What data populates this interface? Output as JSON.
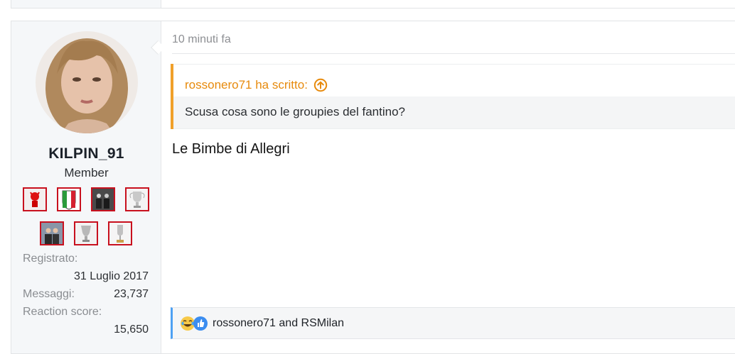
{
  "user": {
    "username": "KILPIN_91",
    "title": "Member",
    "badges": [
      {
        "name": "devil-trophy-badge"
      },
      {
        "name": "italian-shield-badge"
      },
      {
        "name": "team-photo-badge"
      },
      {
        "name": "champions-cup-badge"
      },
      {
        "name": "group-photo-badge"
      },
      {
        "name": "silver-cup-badge"
      },
      {
        "name": "club-cup-badge"
      }
    ],
    "stats": {
      "registered_label": "Registrato:",
      "registered_value": "31 Luglio 2017",
      "messages_label": "Messaggi:",
      "messages_value": "23,737",
      "reaction_label": "Reaction score:",
      "reaction_value": "15,650"
    }
  },
  "post": {
    "time": "10 minuti fa",
    "quote": {
      "author_line": "rossonero71 ha scritto:",
      "text": "Scusa cosa sono le groupies del fantino?"
    },
    "message": "Le Bimbe di Allegri",
    "reactions": {
      "icons": [
        "laughing-face-icon",
        "thumbs-up-icon"
      ],
      "users": "rossonero71 and RSMilan"
    }
  },
  "colors": {
    "quote_accent": "#f0a02a",
    "quote_author": "#e78a0c",
    "reaction_accent": "#4ea1f3",
    "badge_border": "#c8101e",
    "sidebar_bg": "#f5f7f9"
  }
}
